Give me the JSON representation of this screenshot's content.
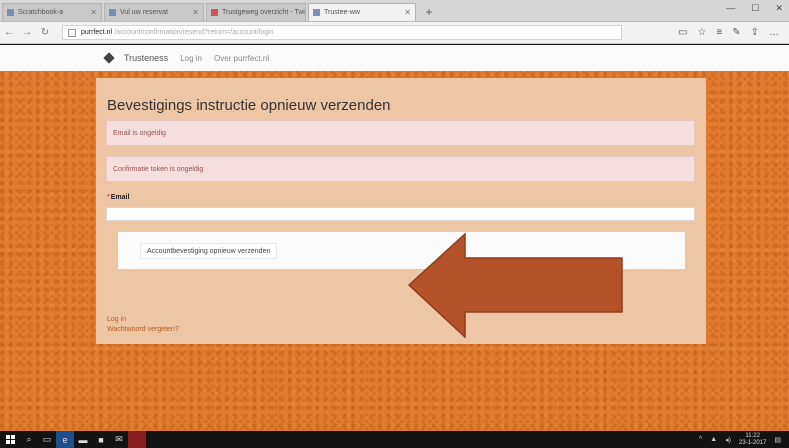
{
  "browser": {
    "tabs": [
      {
        "label": "Scratchbook-a"
      },
      {
        "label": "Vul uw reservat"
      },
      {
        "label": "Trustgeweg overzicht - Twi"
      },
      {
        "label": "Trustee-ww",
        "active": true
      }
    ],
    "address": {
      "host": "purrfect.nl",
      "path": "/account/confirmation/resend?return=/account/login"
    }
  },
  "site": {
    "brand": "Trusteness",
    "nav": [
      "Log in",
      "Over purrfect.nl"
    ]
  },
  "card": {
    "title": "Bevestigings instructie opnieuw verzenden",
    "alerts": [
      "Email is ongeldig",
      "Confirmatie token is ongeldig"
    ],
    "email_label": "Email",
    "email_value": "",
    "resend_button": "Accountbevestiging opnieuw verzenden",
    "links": [
      "Log in",
      "Wachtwoord vergeten?"
    ]
  },
  "taskbar": {
    "clock_time": "11:22",
    "clock_date": "23-1-2017"
  },
  "colors": {
    "page_background": "#e07a2d",
    "card": "#efc6a4",
    "alert_background": "#f4dede",
    "arrow": "#b4522a"
  },
  "icons": [
    "back-icon",
    "forward-icon",
    "refresh-icon",
    "star-icon",
    "windows-start-icon",
    "search-icon",
    "edge-icon"
  ]
}
